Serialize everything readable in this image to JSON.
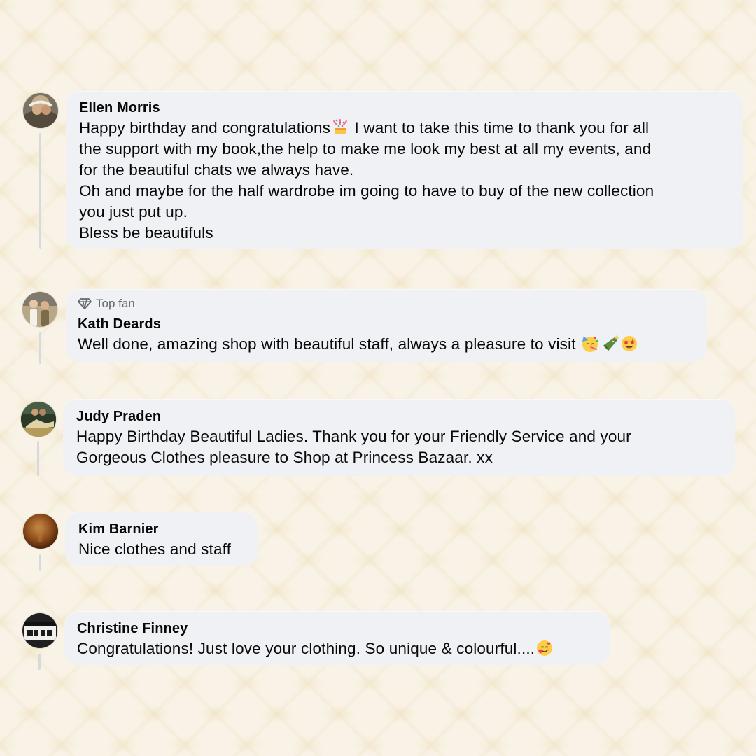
{
  "comments": [
    {
      "name": "Ellen Morris",
      "lines": [
        "Happy birthday and congratulations",
        " I want to take this time to thank you for all",
        "the support with my book,the help to make me look my best at all my events, and",
        "for the beautiful chats we always have.",
        "Oh and maybe for the half wardrobe im going to have to buy of the new collection",
        "you just put up.",
        "Bless be beautifuls"
      ],
      "emojis": [
        "party-confetti-icon"
      ]
    },
    {
      "badge": "Top fan",
      "badge_icon": "diamond-icon",
      "name": "Kath Deards",
      "text": "Well done, amazing shop with beautiful staff, always a pleasure to visit",
      "emojis": [
        "partying-face-icon",
        "champagne-bottle-icon",
        "star-struck-face-icon"
      ]
    },
    {
      "name": "Judy Praden",
      "lines": [
        "Happy Birthday Beautiful Ladies. Thank you for your Friendly Service and your",
        "Gorgeous Clothes pleasure to Shop at Princess Bazaar. xx"
      ]
    },
    {
      "name": "Kim Barnier",
      "text": "Nice clothes and staff"
    },
    {
      "name": "Christine Finney",
      "text": "Congratulations! Just love your clothing. So unique & colourful....",
      "emojis": [
        "smiling-face-with-hearts-icon"
      ]
    }
  ],
  "colors": {
    "background": "#f8f3e6",
    "bubble": "#f0f1f4",
    "text": "#080809",
    "muted": "#65676b",
    "thread": "#d8d9dd"
  }
}
